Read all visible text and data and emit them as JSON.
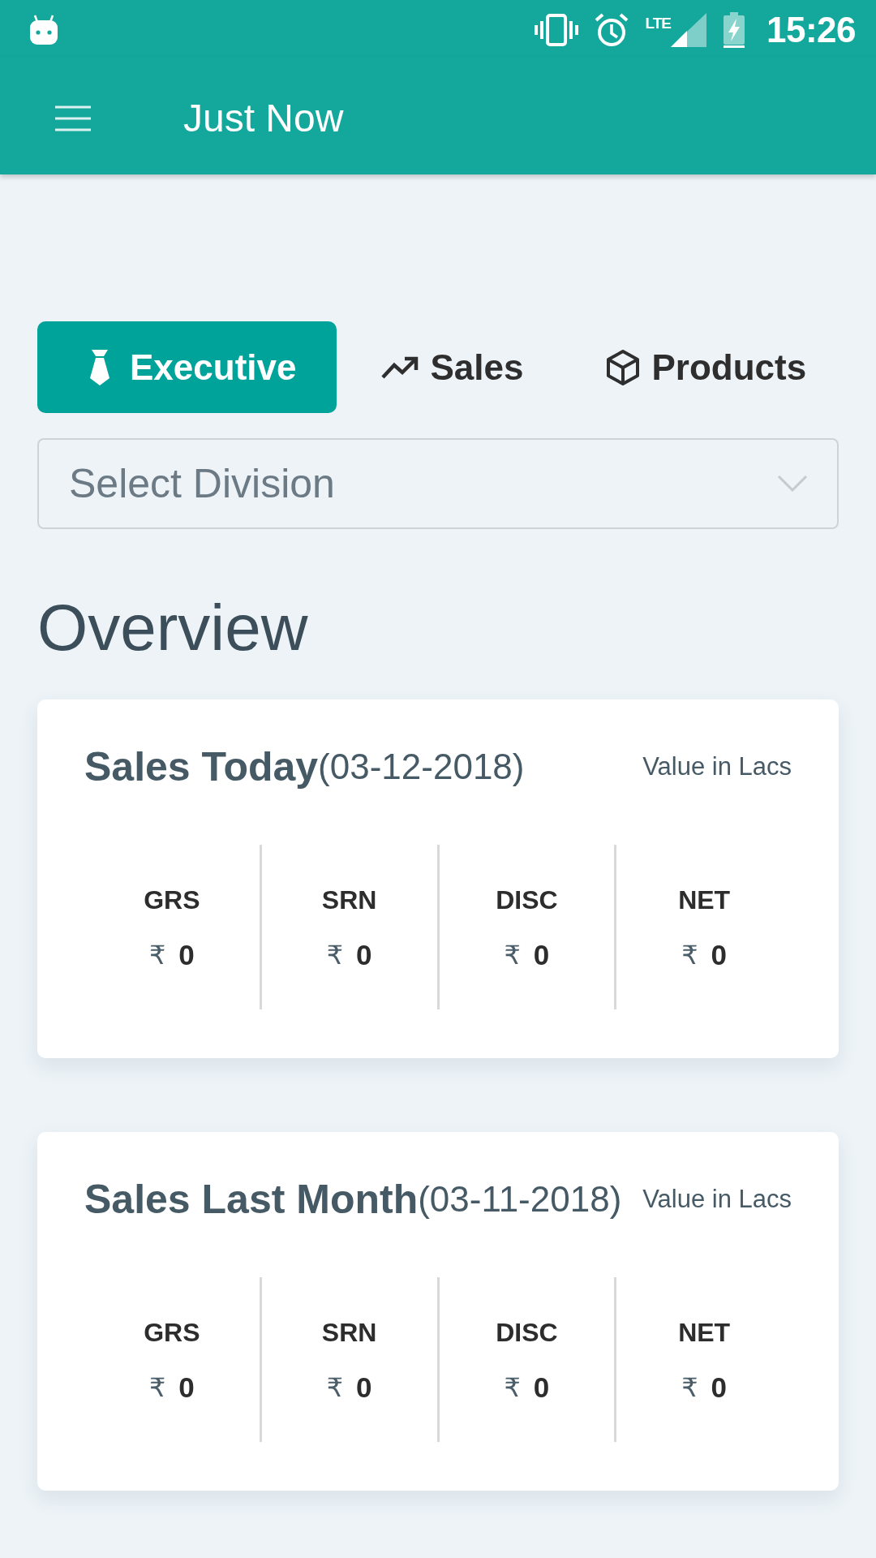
{
  "status_bar": {
    "network": "LTE",
    "time": "15:26"
  },
  "app_bar": {
    "title": "Just Now"
  },
  "tabs": [
    {
      "label": "Executive",
      "selected": true
    },
    {
      "label": "Sales",
      "selected": false
    },
    {
      "label": "Products",
      "selected": false
    }
  ],
  "division_select": {
    "placeholder": "Select Division"
  },
  "section_title": "Overview",
  "cards": [
    {
      "title": "Sales Today",
      "date": "(03-12-2018)",
      "unit_note": "Value in Lacs",
      "metrics": [
        {
          "label": "GRS",
          "currency": "₹",
          "value": "0"
        },
        {
          "label": "SRN",
          "currency": "₹",
          "value": "0"
        },
        {
          "label": "DISC",
          "currency": "₹",
          "value": "0"
        },
        {
          "label": "NET",
          "currency": "₹",
          "value": "0"
        }
      ]
    },
    {
      "title": "Sales Last Month",
      "date": "(03-11-2018)",
      "unit_note": "Value in Lacs",
      "metrics": [
        {
          "label": "GRS",
          "currency": "₹",
          "value": "0"
        },
        {
          "label": "SRN",
          "currency": "₹",
          "value": "0"
        },
        {
          "label": "DISC",
          "currency": "₹",
          "value": "0"
        },
        {
          "label": "NET",
          "currency": "₹",
          "value": "0"
        }
      ]
    }
  ]
}
